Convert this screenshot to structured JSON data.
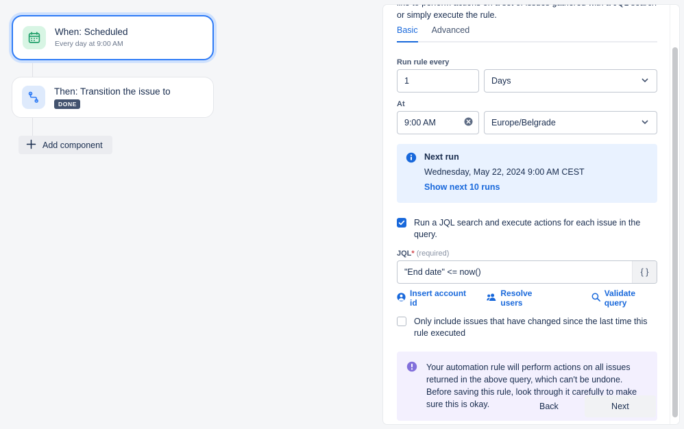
{
  "canvas": {
    "when_node": {
      "icon": "calendar-icon",
      "title": "When: Scheduled",
      "subtitle": "Every day at 9:00 AM"
    },
    "then_node": {
      "icon": "branch-transition-icon",
      "title": "Then: Transition the issue to",
      "badge": "DONE"
    },
    "add_component_label": "Add component"
  },
  "panel": {
    "intro": "like to perform actions on a set of issues gathered with a JQL search or simply execute the rule.",
    "tabs": [
      {
        "label": "Basic",
        "active": true
      },
      {
        "label": "Advanced",
        "active": false
      }
    ],
    "run_rule_every": {
      "label": "Run rule every",
      "interval_value": "1",
      "unit_value": "Days"
    },
    "at": {
      "label": "At",
      "time_value": "9:00 AM",
      "timezone_value": "Europe/Belgrade"
    },
    "next_run": {
      "icon": "info-icon",
      "title": "Next run",
      "date": "Wednesday, May 22, 2024 9:00 AM CEST",
      "link": "Show next 10 runs"
    },
    "jql_checkbox": {
      "checked": true,
      "label": "Run a JQL search and execute actions for each issue in the query."
    },
    "jql_field": {
      "label": "JQL",
      "required_star": "*",
      "required_note": "(required)",
      "value": "\"End date\" <= now()",
      "brace_button": "{ }"
    },
    "jql_actions": [
      {
        "icon": "person-icon",
        "label": "Insert account id"
      },
      {
        "icon": "people-icon",
        "label": "Resolve users"
      },
      {
        "icon": "search-icon",
        "label": "Validate query"
      }
    ],
    "changed_checkbox": {
      "checked": false,
      "label": "Only include issues that have changed since the last time this rule executed"
    },
    "warning": {
      "icon": "warning-icon",
      "text": "Your automation rule will perform actions on all issues returned in the above query, which can't be undone. Before saving this rule, look through it carefully to make sure this is okay."
    },
    "footer": {
      "back_label": "Back",
      "next_label": "Next"
    }
  },
  "colors": {
    "accent_blue": "#1868db",
    "selected_border": "#2e7bf6",
    "info_bg": "#e9f2ff",
    "warning_bg": "#f3f0fe",
    "warning_icon": "#8270db",
    "badge_bg": "#42526e",
    "page_bg": "#f5f6f8"
  }
}
